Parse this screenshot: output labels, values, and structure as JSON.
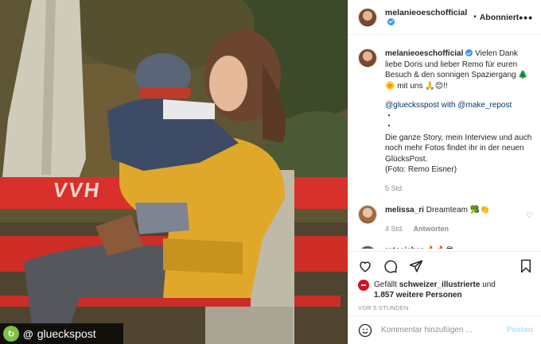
{
  "photo": {
    "bench_text": "VVH",
    "repost_user": "glueckspost",
    "repost_logo": "repost-icon"
  },
  "header": {
    "username": "melanieoeschofficial",
    "separator": "•",
    "follow_label": "Abonniert",
    "more": "•••"
  },
  "caption": {
    "username": "melanieoeschofficial",
    "text": "Vielen Dank liebe Doris und lieber Remo für euren Besuch & den sonnigen Spaziergang 🌲🌞 mit uns 🙏😊!!",
    "line2": "@gluecksspost with @make_repost",
    "line3": "・\n・\nDie ganze Story, mein Interview und auch noch mehr Fotos findet ihr in der neuen GlücksPost.\n(Foto: Remo Eisner)",
    "time": "5 Std."
  },
  "comments": [
    {
      "username": "melissa_ri",
      "text": "Dreamteam 🥦👏",
      "time": "4 Std.",
      "reply": "Antworten"
    },
    {
      "username": "retoeicher",
      "text": "🔥🔥😎",
      "time": "",
      "reply": ""
    }
  ],
  "likes": {
    "prefix": "Gefällt",
    "user": "schweizer_illustrierte",
    "mid": "und",
    "others": "1.857 weitere Personen",
    "date": "VOR 5 STUNDEN"
  },
  "add_comment": {
    "placeholder": "Kommentar hinzufügen ...",
    "post_label": "Posten"
  },
  "colors": {
    "verified": "#3897f0",
    "bench_red": "#d8312b",
    "jacket_yellow": "#e0a82a",
    "link": "#00376b"
  }
}
